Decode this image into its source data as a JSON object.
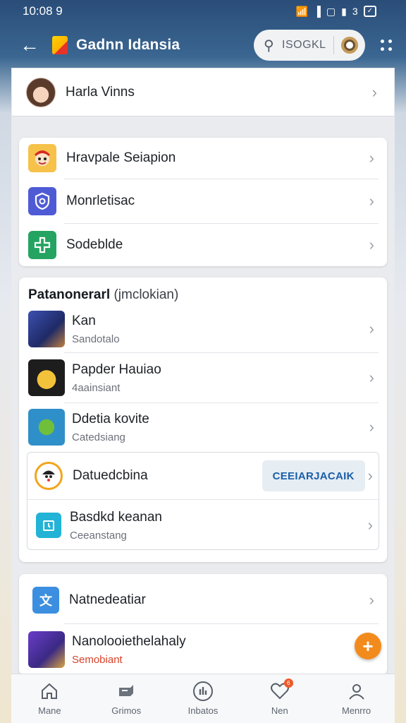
{
  "status_bar": {
    "time": "10:08 9",
    "battery": "3"
  },
  "header": {
    "title": "Gadnn Idansia",
    "search_text": "ISOGKL"
  },
  "profile": {
    "name": "Harla Vinns"
  },
  "menu_card": {
    "items": [
      {
        "label": "Hravpale Seiapion",
        "icon": "mascot-icon",
        "color": "#e53935"
      },
      {
        "label": "Monrletisac",
        "icon": "shield-icon",
        "color": "#4f5bd5"
      },
      {
        "label": "Sodeblde",
        "icon": "health-cross-icon",
        "color": "#24a460"
      }
    ]
  },
  "games_section": {
    "title": "Patanonerarl",
    "subtitle": "(jmclokian)",
    "games": [
      {
        "title": "Kan",
        "subtitle": "Sandotalo"
      },
      {
        "title": "Papder Hauiao",
        "subtitle": "4aainsiant"
      },
      {
        "title": "Ddetia kovite",
        "subtitle": "Catedsiang"
      }
    ],
    "inner": {
      "row1_title": "Datuedcbina",
      "row1_button": "CEEIARJACAIK",
      "row2_title": "Basdkd keanan",
      "row2_subtitle": "Ceeanstang"
    }
  },
  "bottom_card": {
    "row1_title": "Natnedeatiar",
    "row2_title": "Nanolooiethelahaly",
    "row2_subtitle": "Semobiant",
    "accent": "#f38b1c"
  },
  "bottom_nav": {
    "items": [
      {
        "label": "Mane"
      },
      {
        "label": "Grimos"
      },
      {
        "label": "Inbatos"
      },
      {
        "label": "Nen",
        "badge": "6"
      },
      {
        "label": "Menrro"
      }
    ]
  }
}
